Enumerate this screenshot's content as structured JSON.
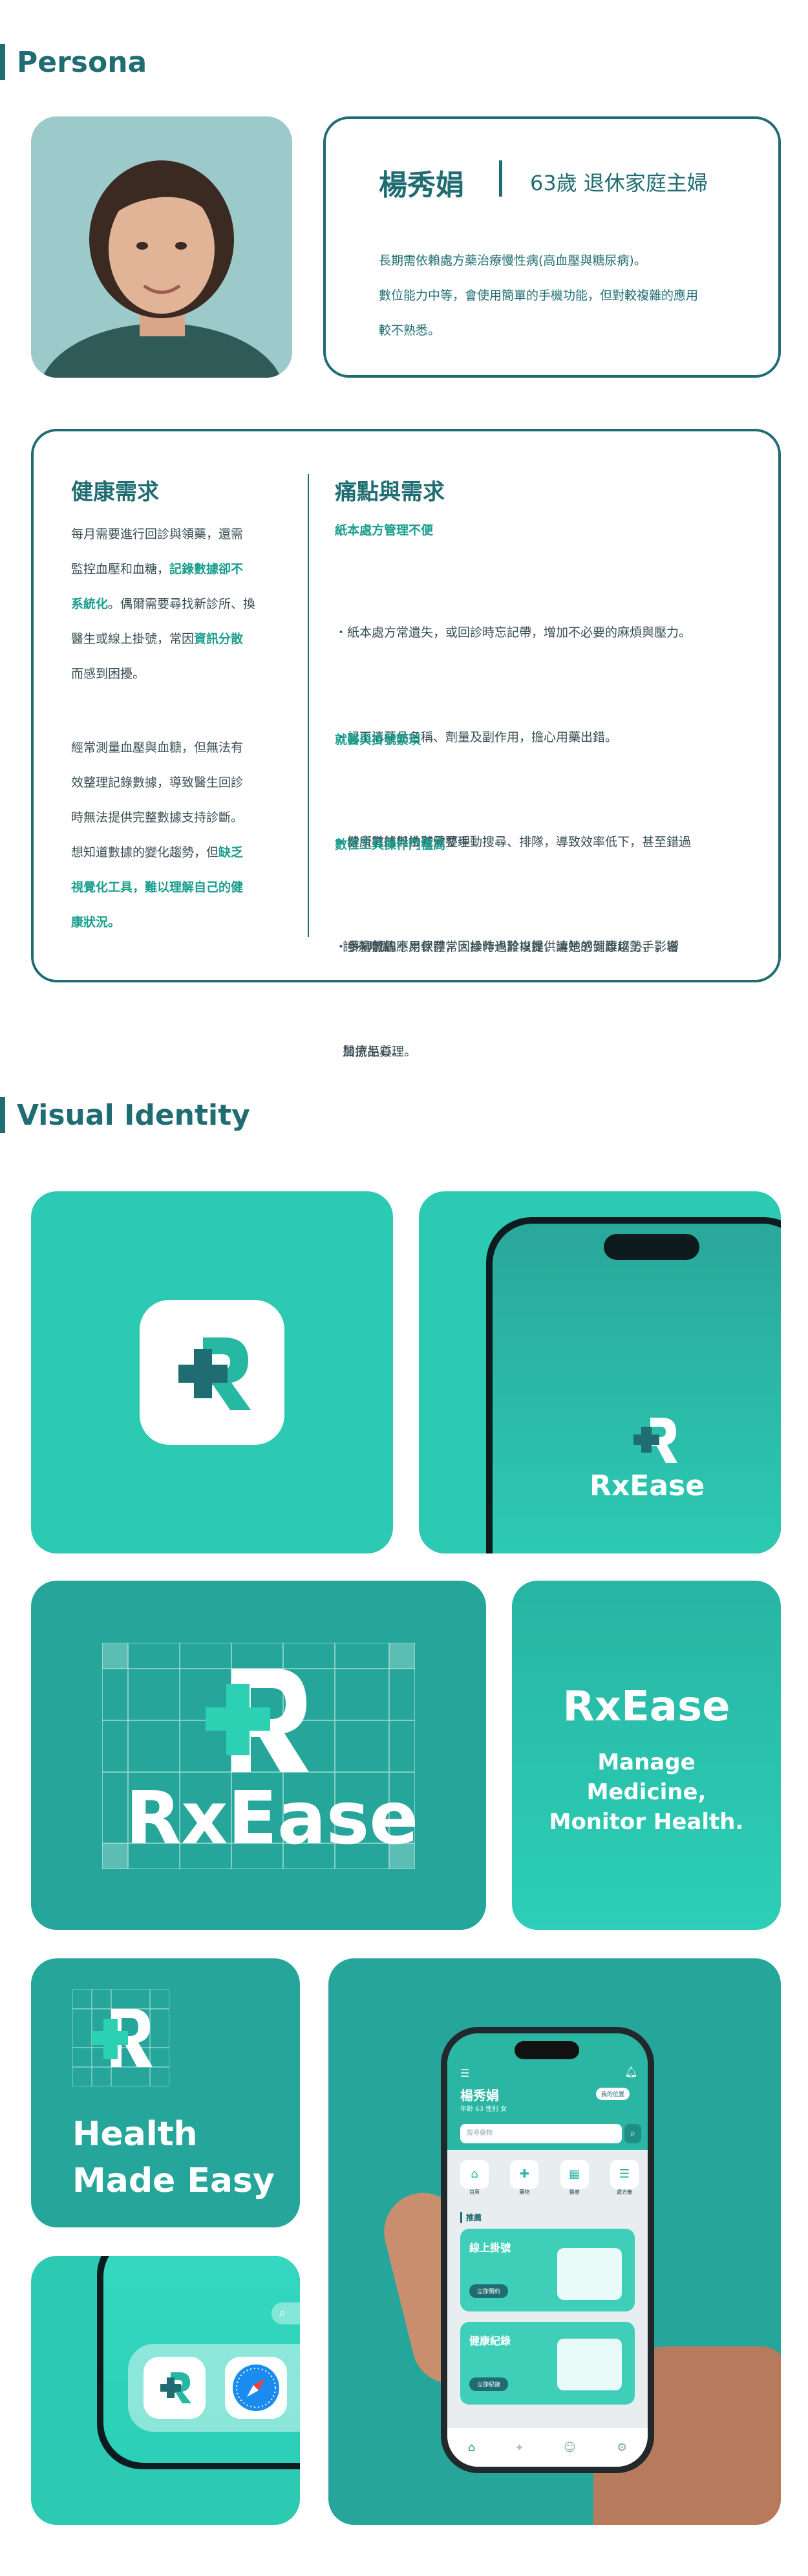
{
  "persona_section": {
    "title": "Persona"
  },
  "persona": {
    "name": "楊秀娟",
    "age_role": "63歲 退休家庭主婦",
    "desc_1": "長期需依賴處方藥治療慢性病(高血壓與糖尿病)。",
    "desc_2": "數位能力中等，會使用簡單的手機功能，但對較複雜的應用",
    "desc_3": "較不熟悉。"
  },
  "health_needs": {
    "title": "健康需求",
    "p1": [
      [
        "每月需要進行回診與領藥，還需",
        ""
      ],
      [
        "監控血壓和血糖，",
        "記錄數據卻不"
      ],
      [
        "系統化",
        "。偶爾需要尋找新診所、換"
      ],
      [
        "醫生或線上掛號，常因",
        "資訊分散"
      ],
      [
        "而感到困擾。",
        ""
      ]
    ],
    "p2": [
      [
        "經常測量血壓與血糖，但無法有",
        ""
      ],
      [
        "效整理記錄數據，導致醫生回診",
        ""
      ],
      [
        "時無法提供完整數據支持診斷。",
        ""
      ],
      [
        "想知道數據的變化趨勢，但",
        "缺乏"
      ],
      [
        "",
        "視覺化工具，難以理解自己的健"
      ],
      [
        "",
        "康狀況。"
      ]
    ]
  },
  "pain_points": {
    "title": "痛點與需求",
    "g1_title": "紙本處方管理不便",
    "g1": [
      "・紙本處方常遺失，或回診時忘記帶，增加不必要的麻煩與壓力。",
      "・記不清藥品名稱、劑量及副作用，擔心用藥出錯。",
      "・健康數據無法有效整理",
      "・手寫數據不易保存，回診時也難以提供清楚的健康趨勢，影響",
      "  醫療品質。"
    ],
    "g2_title": "就醫與掛號繁瑣",
    "g2": [
      "・診所導航與掛號需要手動搜尋、排隊，導致效率低下，甚至錯過",
      "  診療時間。"
    ],
    "g3_title": "數位工具操作門檻高",
    "g3": [
      "・多功能的應用軟體常因操作過於複雜，讓她感到難以上手，增",
      "  加抗拒心理。"
    ]
  },
  "visual_section": {
    "title": "Visual Identity"
  },
  "brand": {
    "name_rx": "Rx",
    "name_ease": "Ease",
    "full_name": "RxEase",
    "tagline_1": "Manage",
    "tagline_2": "Medicine,",
    "tagline_3": "Monitor Health.",
    "slogan_1": "Health",
    "slogan_2": "Made Easy"
  },
  "app_mock": {
    "user_name": "楊秀娟",
    "user_meta": "年齡 63  性別 女",
    "location_chip": "我的位置",
    "search_placeholder": "搜尋藥物",
    "quick_actions": [
      "首頁",
      "藥物",
      "醫療",
      "處方籤"
    ],
    "recommend_label": "推薦",
    "card1_title": "線上掛號",
    "card1_button": "立即預約",
    "card2_title": "健康紀錄",
    "card2_button": "立即紀錄"
  },
  "colors": {
    "primary": "#1f6d72",
    "accent": "#2cc9b3",
    "highlight": "#1a9e8e"
  }
}
